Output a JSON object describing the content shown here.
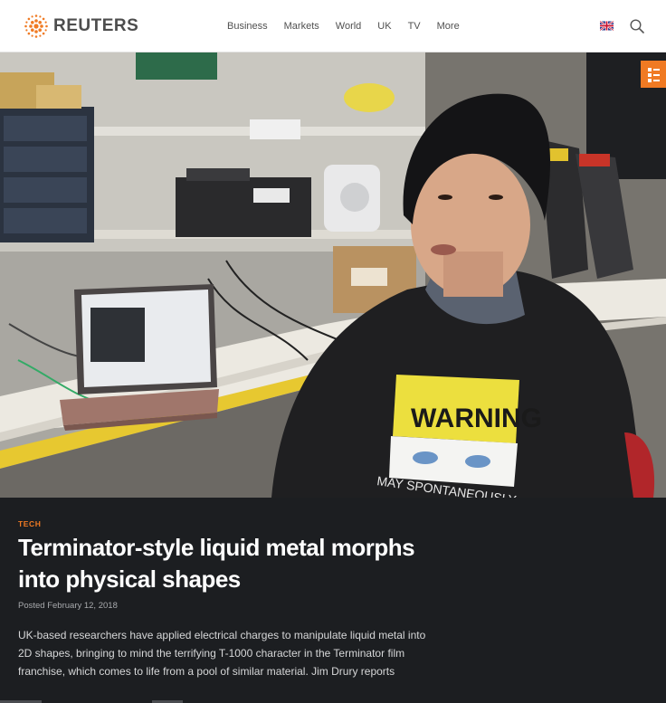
{
  "header": {
    "logo_text": "REUTERS",
    "nav_items": [
      "Business",
      "Markets",
      "World",
      "UK",
      "TV",
      "More"
    ],
    "region_flag": "uk-flag-icon",
    "search_icon": "search-icon"
  },
  "video": {
    "share_icon": "share-icon",
    "shirt_text_1": "WARNING",
    "shirt_text_2": "MAY SPONTANEOUSLY"
  },
  "article": {
    "category": "TECH",
    "title": "Terminator-style liquid metal morphs into physical shapes",
    "posted": "Posted February 12, 2018",
    "summary": "UK-based researchers have applied electrical charges to manipulate liquid metal into 2D shapes, bringing to mind the terrifying T-1000 character in the Terminator film franchise, which comes to life from a pool of similar material. Jim Drury reports"
  },
  "colors": {
    "accent": "#f07a23",
    "background": "#1c1e21",
    "header_bg": "#ffffff",
    "title": "#ffffff"
  }
}
